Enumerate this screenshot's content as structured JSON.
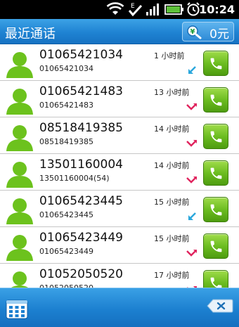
{
  "status_bar": {
    "time": "10:24",
    "icons": [
      "wifi-icon",
      "edge-network-icon",
      "check-icon",
      "signal-icon",
      "battery-icon",
      "alarm-icon"
    ],
    "network_label": "E"
  },
  "header": {
    "title": "最近通话",
    "balance": "0元",
    "balance_icon": "search-coin-icon"
  },
  "calls": [
    {
      "number": "01065421034",
      "detail": "01065421034",
      "time": "1 小时前",
      "type": "incoming"
    },
    {
      "number": "01065421483",
      "detail": "01065421483",
      "time": "13 小时前",
      "type": "missed"
    },
    {
      "number": "08518419385",
      "detail": "08518419385",
      "time": "14 小时前",
      "type": "missed"
    },
    {
      "number": "13501160004",
      "detail": "13501160004(54)",
      "time": "14 小时前",
      "type": "missed"
    },
    {
      "number": "01065423445",
      "detail": "01065423445",
      "time": "15 小时前",
      "type": "incoming"
    },
    {
      "number": "01065423449",
      "detail": "01065423449",
      "time": "15 小时前",
      "type": "missed"
    },
    {
      "number": "01052050520",
      "detail": "01052050520",
      "time": "17 小时前",
      "type": "missed"
    }
  ],
  "bottom_bar": {
    "keypad_icon": "dialpad-icon",
    "delete_icon": "backspace-icon"
  },
  "colors": {
    "header_blue": "#1f83d2",
    "dial_green": "#6cbd21",
    "avatar_green": "#6cc21d",
    "incoming_arrow": "#2aa7dc",
    "missed_arrow": "#e0245e"
  }
}
